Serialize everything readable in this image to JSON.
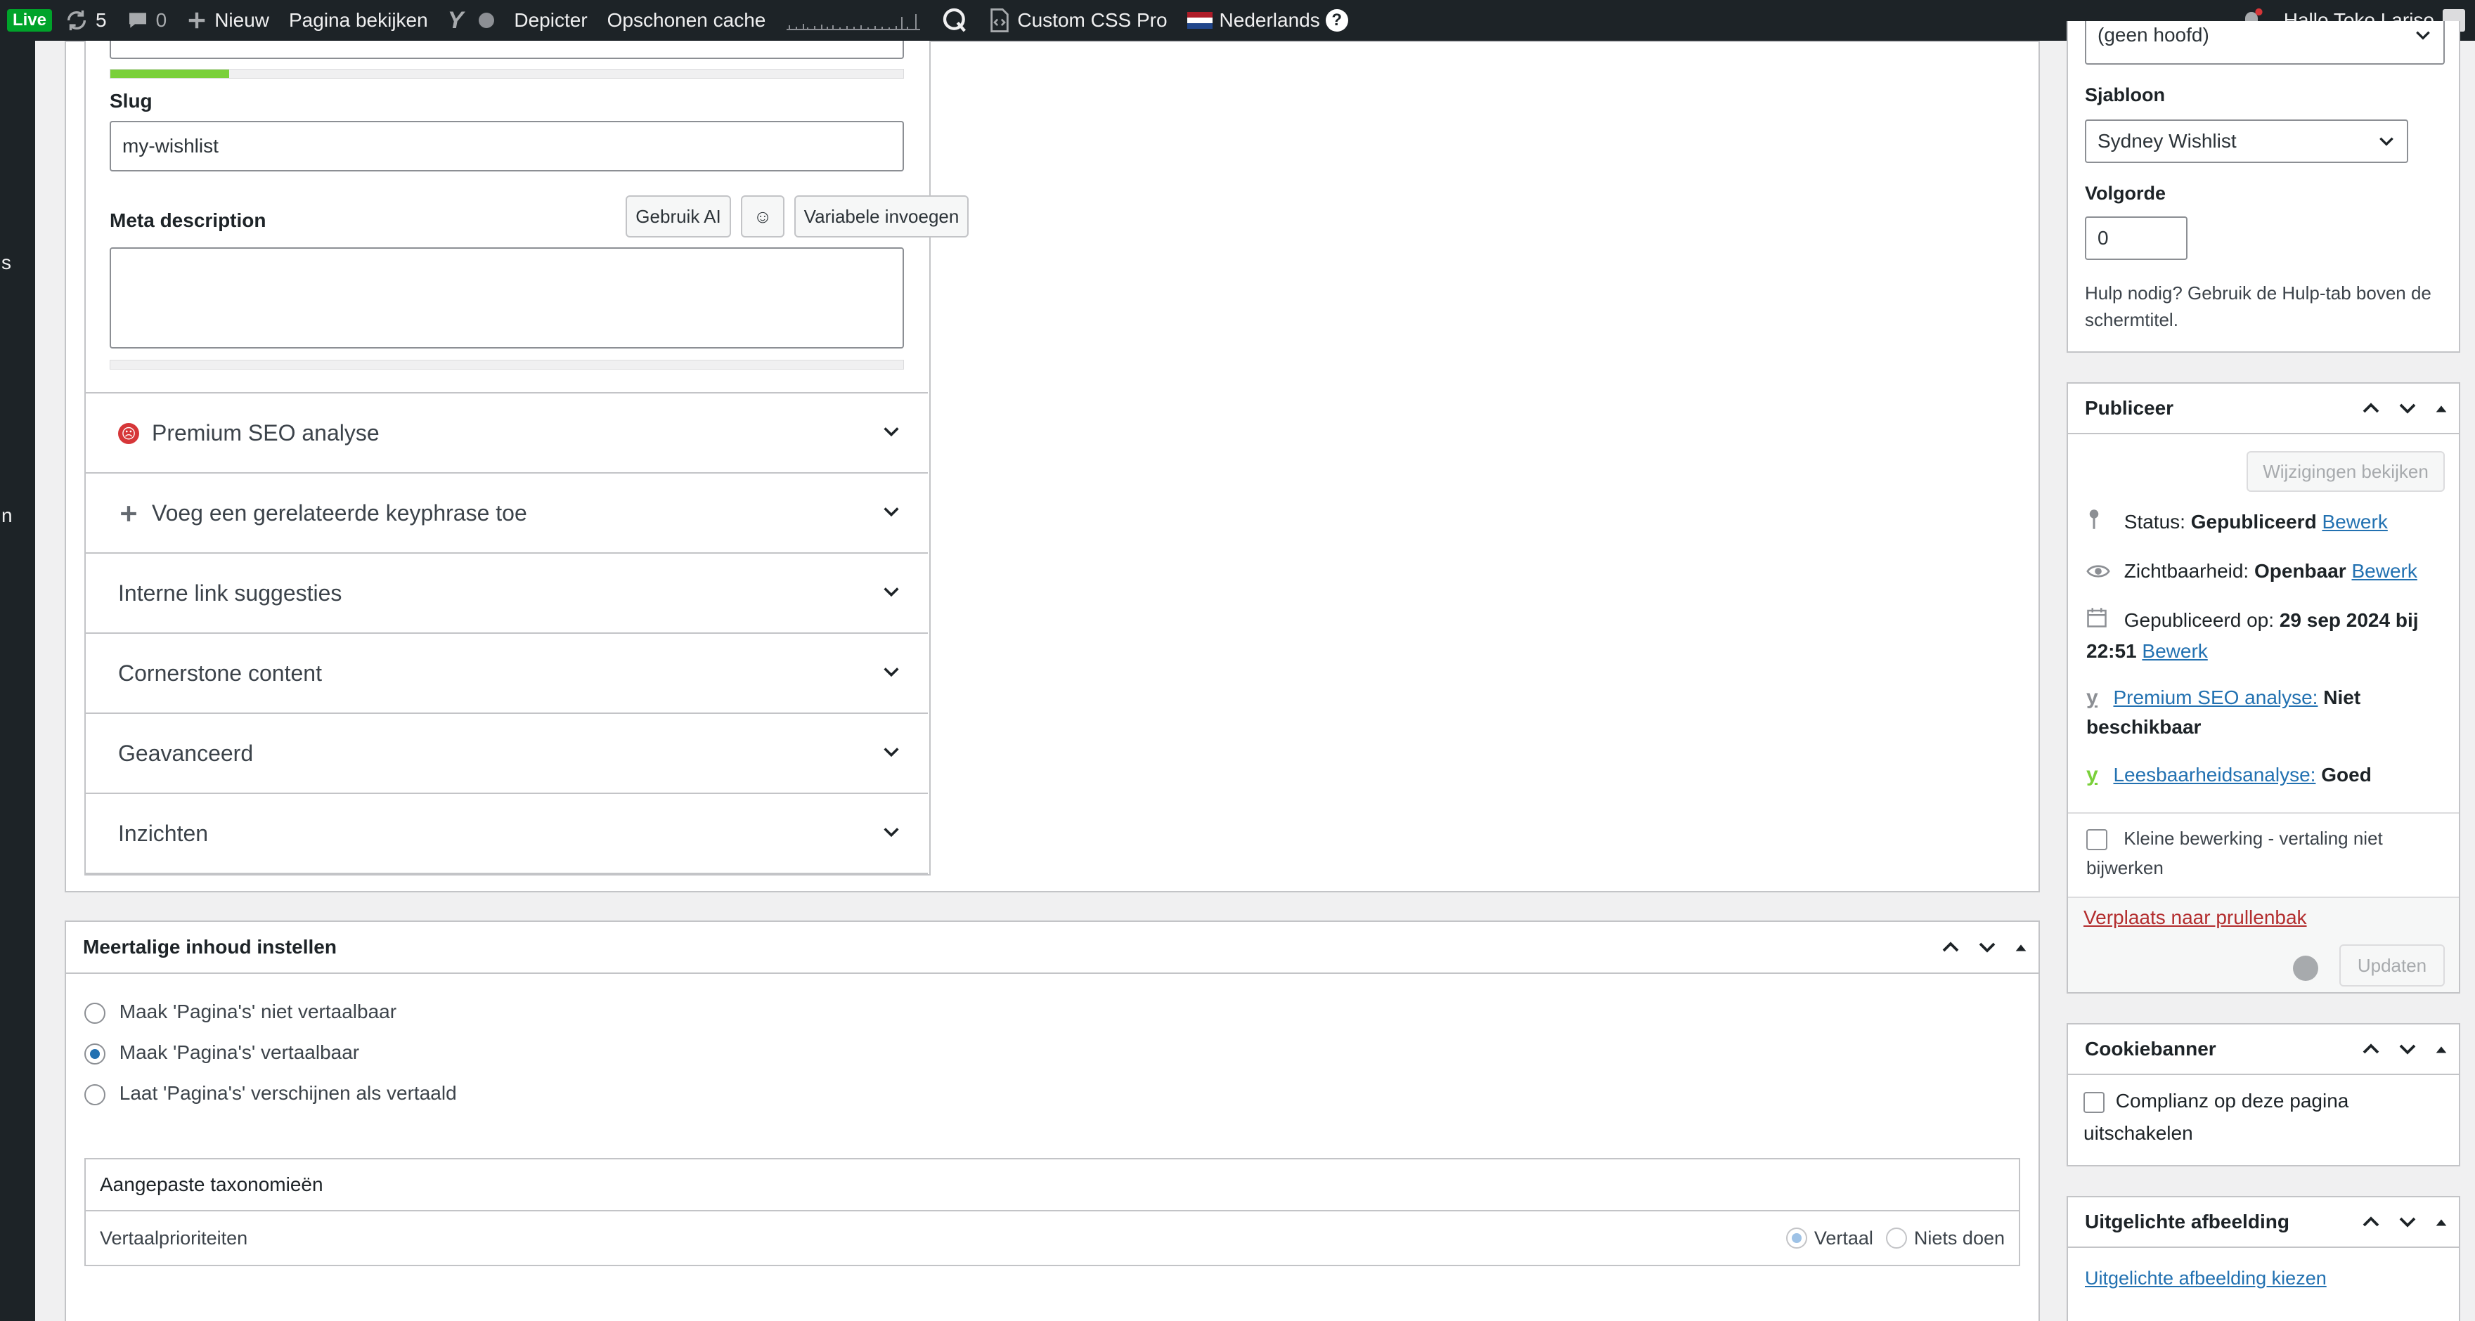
{
  "adminbar": {
    "live": "Live",
    "updates_count": "5",
    "comments_count": "0",
    "new_label": "Nieuw",
    "view_page": "Pagina bekijken",
    "depicter": "Depicter",
    "clear_cache": "Opschonen cache",
    "custom_css": "Custom CSS Pro",
    "language": "Nederlands",
    "help": "?",
    "greeting": "Hallo Toko Lariso"
  },
  "leftbar": {
    "letter_1": "s",
    "letter_2": "n"
  },
  "seo": {
    "slug_label": "Slug",
    "slug_value": "my-wishlist",
    "meta_label": "Meta description",
    "btn_ai": "Gebruik AI",
    "btn_emoji": "☺",
    "btn_variable": "Variabele invoegen",
    "progress": 0.15,
    "accordion": [
      {
        "label": "Premium SEO analyse"
      },
      {
        "label": "Voeg een gerelateerde keyphrase toe"
      },
      {
        "label": "Interne link suggesties"
      },
      {
        "label": "Cornerstone content"
      },
      {
        "label": "Geavanceerd"
      },
      {
        "label": "Inzichten"
      }
    ]
  },
  "multilingual": {
    "title": "Meertalige inhoud instellen",
    "options": [
      "Maak 'Pagina's' niet vertaalbaar",
      "Maak 'Pagina's' vertaalbaar",
      "Laat 'Pagina's' verschijnen als vertaald"
    ],
    "selected_index": 1,
    "custom_tax": "Aangepaste taxonomieën",
    "priorities": "Vertaalprioriteiten",
    "opt_translate": "Vertaal",
    "opt_nothing": "Niets doen"
  },
  "attributes": {
    "parent_value": "(geen hoofd)",
    "template_label": "Sjabloon",
    "template_value": "Sydney Wishlist",
    "order_label": "Volgorde",
    "order_value": "0",
    "help_text": "Hulp nodig? Gebruik de Hulp-tab boven de schermtitel."
  },
  "publish": {
    "title": "Publiceer",
    "preview_btn": "Wijzigingen bekijken",
    "status_label": "Status:",
    "status_value": "Gepubliceerd",
    "visibility_label": "Zichtbaarheid:",
    "visibility_value": "Openbaar",
    "published_label": "Gepubliceerd op:",
    "published_value": "29 sep 2024 bij",
    "published_time": "22:51",
    "edit": "Bewerk",
    "seo_link": "Premium SEO analyse:",
    "seo_value": "Niet",
    "seo_value_2": "beschikbaar",
    "read_link": "Leesbaarheidsanalyse:",
    "read_value": "Goed",
    "minor_edit": "Kleine bewerking - vertaling niet",
    "minor_edit_2": "bijwerken",
    "trash": "Verplaats naar prullenbak",
    "update_btn": "Updaten"
  },
  "cookie": {
    "title": "Cookiebanner",
    "option": "Complianz op deze pagina",
    "option_2": "uitschakelen"
  },
  "featured": {
    "title": "Uitgelichte afbeelding",
    "link": "Uitgelichte afbeelding kiezen"
  },
  "colors": {
    "accent": "#2271b1",
    "success": "#00a32a",
    "danger": "#d63638",
    "adminbar": "#1d2327"
  }
}
